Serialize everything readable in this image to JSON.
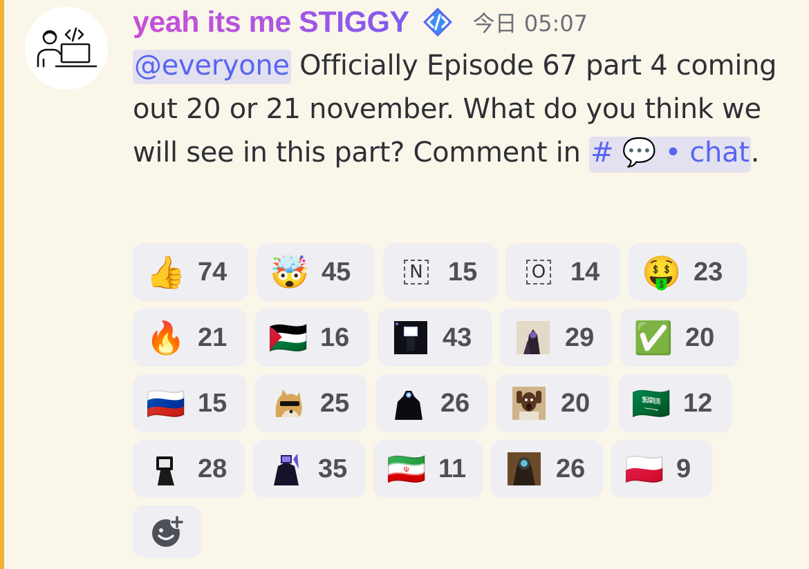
{
  "colors": {
    "mention_bar": "#f0b232",
    "username_gradient": [
      "#c94fd6",
      "#7b5cf0"
    ],
    "link": "#5865f2",
    "reaction_bg": "#efeef2"
  },
  "author": {
    "name": "yeah its me STIGGY",
    "badge_icon": "code-developer-badge-icon",
    "timestamp": "今日 05:07"
  },
  "message": {
    "mention": "@everyone",
    "text_1": " Officially Episode 67 part 4 coming out 20 or 21 november. What do you think we will see in this part? Comment in ",
    "channel_hash": "#",
    "channel_emoji": "💬",
    "channel_name": " • chat",
    "text_end": "."
  },
  "reactions": [
    [
      {
        "icon": "thumbs-up-icon",
        "glyph": "👍",
        "count": "74"
      },
      {
        "icon": "exploding-head-icon",
        "glyph": "🤯",
        "count": "45"
      },
      {
        "icon": "letter-n-icon",
        "glyph": "N",
        "count": "15"
      },
      {
        "icon": "letter-o-icon",
        "glyph": "O",
        "count": "14"
      },
      {
        "icon": "money-mouth-face-icon",
        "glyph": "🤑",
        "count": "23"
      }
    ],
    [
      {
        "icon": "fire-icon",
        "glyph": "🔥",
        "count": "21"
      },
      {
        "icon": "palestine-flag-icon",
        "glyph": "🇵🇸",
        "count": "16"
      },
      {
        "icon": "custom-tv-man-emoji-icon",
        "glyph": "",
        "count": "43"
      },
      {
        "icon": "custom-titan-emoji-icon",
        "glyph": "",
        "count": "29"
      },
      {
        "icon": "check-mark-button-icon",
        "glyph": "✅",
        "count": "20"
      }
    ],
    [
      {
        "icon": "russia-flag-icon",
        "glyph": "🇷🇺",
        "count": "15"
      },
      {
        "icon": "doge-sunglasses-icon",
        "glyph": "",
        "count": "25"
      },
      {
        "icon": "custom-camera-titan-emoji-icon",
        "glyph": "",
        "count": "26"
      },
      {
        "icon": "custom-surprised-man-emoji-icon",
        "glyph": "",
        "count": "20"
      },
      {
        "icon": "saudi-arabia-flag-icon",
        "glyph": "🇸🇦",
        "count": "12"
      }
    ],
    [
      {
        "icon": "custom-tv-head-emoji-icon",
        "glyph": "",
        "count": "28"
      },
      {
        "icon": "custom-tv-titan-emoji-icon",
        "glyph": "",
        "count": "35"
      },
      {
        "icon": "iran-flag-icon",
        "glyph": "🇮🇷",
        "count": "11"
      },
      {
        "icon": "custom-speaker-titan-emoji-icon",
        "glyph": "",
        "count": "26"
      },
      {
        "icon": "poland-flag-icon",
        "glyph": "🇵🇱",
        "count": "9"
      }
    ]
  ],
  "add_reaction": {
    "icon": "add-reaction-icon"
  }
}
